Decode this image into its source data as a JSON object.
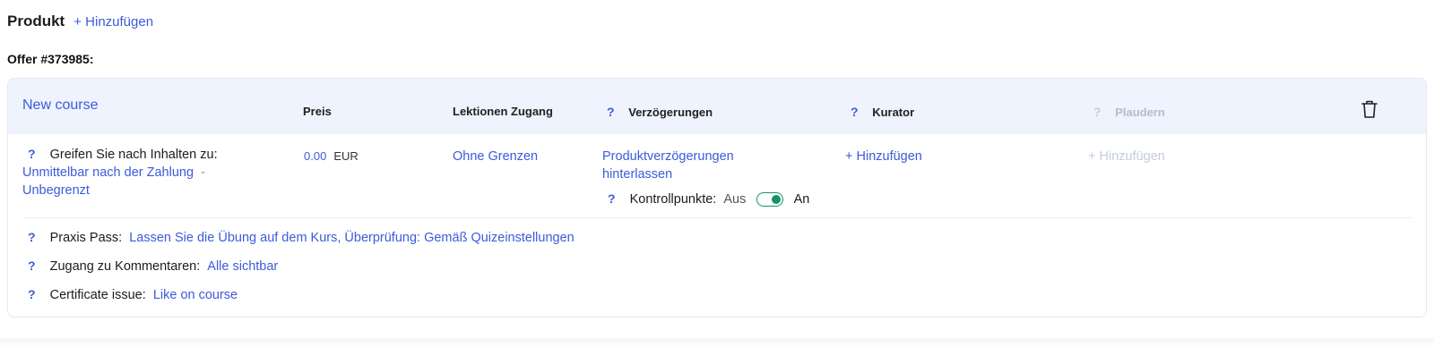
{
  "header": {
    "title": "Produkt",
    "add_label": "+ Hinzufügen"
  },
  "offer": {
    "label": "Offer #373985:"
  },
  "course": {
    "name": "New course",
    "columns": {
      "price": "Preis",
      "lessons_access": "Lektionen Zugang",
      "delays": "Verzögerungen",
      "curator": "Kurator",
      "chat": "Plaudern"
    },
    "help_glyph": "?",
    "content_access": {
      "label": "Greifen Sie nach Inhalten zu:",
      "value_start": "Unmittelbar nach der Zahlung",
      "separator": "-",
      "value_end": "Unbegrenzt"
    },
    "price": {
      "amount": "0.00",
      "currency": "EUR"
    },
    "lessons_access_value": "Ohne Grenzen",
    "delays_value": "Produktverzögerungen hinterlassen",
    "checkpoints": {
      "label": "Kontrollpunkte:",
      "off_label": "Aus",
      "on_label": "An",
      "state": "on"
    },
    "curator_add": "+ Hinzufügen",
    "chat_add": "+ Hinzufügen",
    "practice_pass": {
      "label": "Praxis Pass:",
      "value": "Lassen Sie die Übung auf dem Kurs, Überprüfung: Gemäß Quizeinstellungen"
    },
    "comments_access": {
      "label": "Zugang zu Kommentaren:",
      "value": "Alle sichtbar"
    },
    "certificate": {
      "label": "Certificate issue:",
      "value": "Like on course"
    }
  },
  "colors": {
    "accent": "#3b5bdb",
    "toggle_on": "#12936b",
    "header_bg": "#eef3fd",
    "muted": "#b5bccb"
  },
  "icons": {
    "delete": "trash-icon",
    "help": "help-icon"
  }
}
